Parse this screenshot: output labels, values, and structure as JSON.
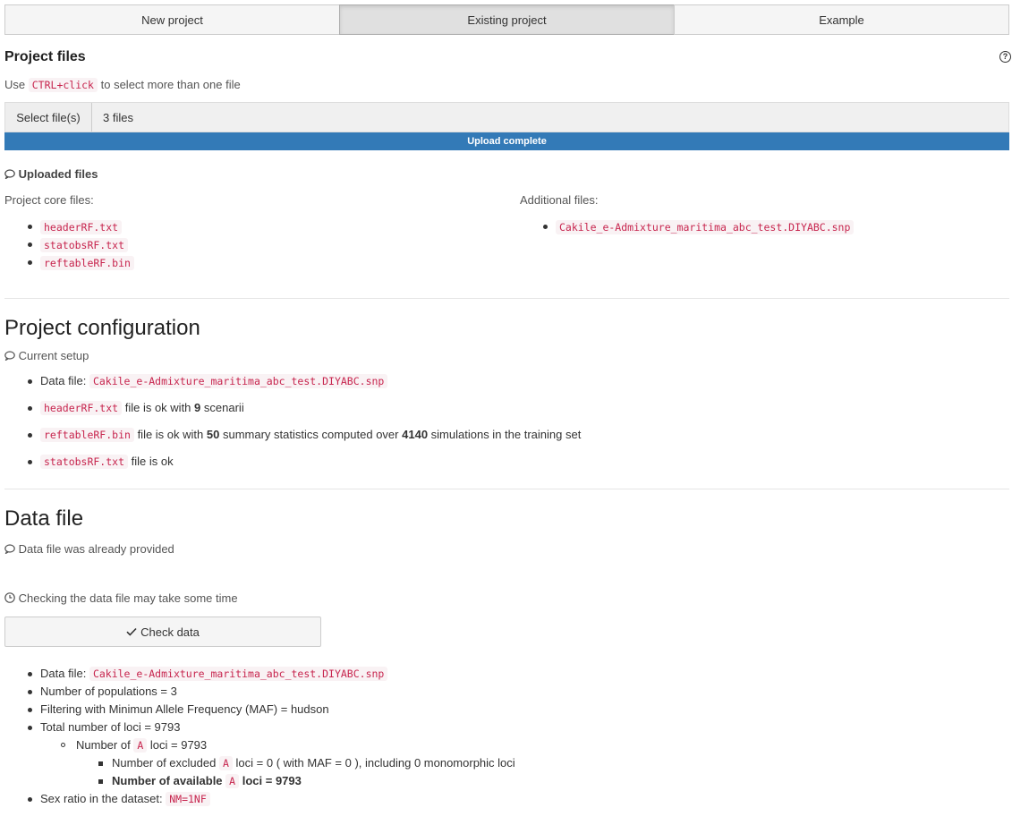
{
  "tabs": [
    "New project",
    "Existing project",
    "Example"
  ],
  "project_files": {
    "title": "Project files",
    "help_icon": "question-circle-icon",
    "hint_prefix": "Use",
    "hint_key": "CTRL+click",
    "hint_suffix": "to select more than one file",
    "select_label": "Select file(s)",
    "selected_text": "3 files",
    "progress_label": "Upload complete",
    "progress_fraction": 1.0,
    "uploaded_heading": "Uploaded files",
    "core_label": "Project core files:",
    "core_files": [
      "headerRF.txt",
      "statobsRF.txt",
      "reftableRF.bin"
    ],
    "additional_label": "Additional files:",
    "additional_files": [
      "Cakile_e-Admixture_maritima_abc_test.DIYABC.snp"
    ]
  },
  "config": {
    "title": "Project configuration",
    "subtitle": "Current setup",
    "data_file_label": "Data file:",
    "data_file": "Cakile_e-Admixture_maritima_abc_test.DIYABC.snp",
    "header_file": "headerRF.txt",
    "header_text_a": "file is ok with",
    "header_scenarii": "9",
    "header_text_b": "scenarii",
    "reftable_file": "reftableRF.bin",
    "reftable_text_a": "file is ok with",
    "reftable_stats": "50",
    "reftable_text_b": "summary statistics computed over",
    "reftable_sims": "4140",
    "reftable_text_c": "simulations in the training set",
    "statobs_file": "statobsRF.txt",
    "statobs_text": "file is ok"
  },
  "data_file": {
    "title": "Data file",
    "provided_note": "Data file was already provided",
    "time_note": "Checking the data file may take some time",
    "check_button": "Check data",
    "details": {
      "data_file_label": "Data file:",
      "data_file": "Cakile_e-Admixture_maritima_abc_test.DIYABC.snp",
      "populations": "Number of populations = 3",
      "maf": "Filtering with Minimun Allele Frequency (MAF) = hudson",
      "total_loci": "Total number of loci = 9793",
      "loci_a_prefix": "Number of",
      "loci_a_code": "A",
      "loci_a_suffix": "loci = 9793",
      "excluded_prefix": "Number of excluded",
      "excluded_code": "A",
      "excluded_suffix": "loci = 0 ( with MAF = 0 ), including 0 monomorphic loci",
      "available_prefix": "Number of available",
      "available_code": "A",
      "available_suffix": "loci = 9793",
      "sex_ratio_label": "Sex ratio in the dataset:",
      "sex_ratio": "NM=1NF"
    }
  }
}
